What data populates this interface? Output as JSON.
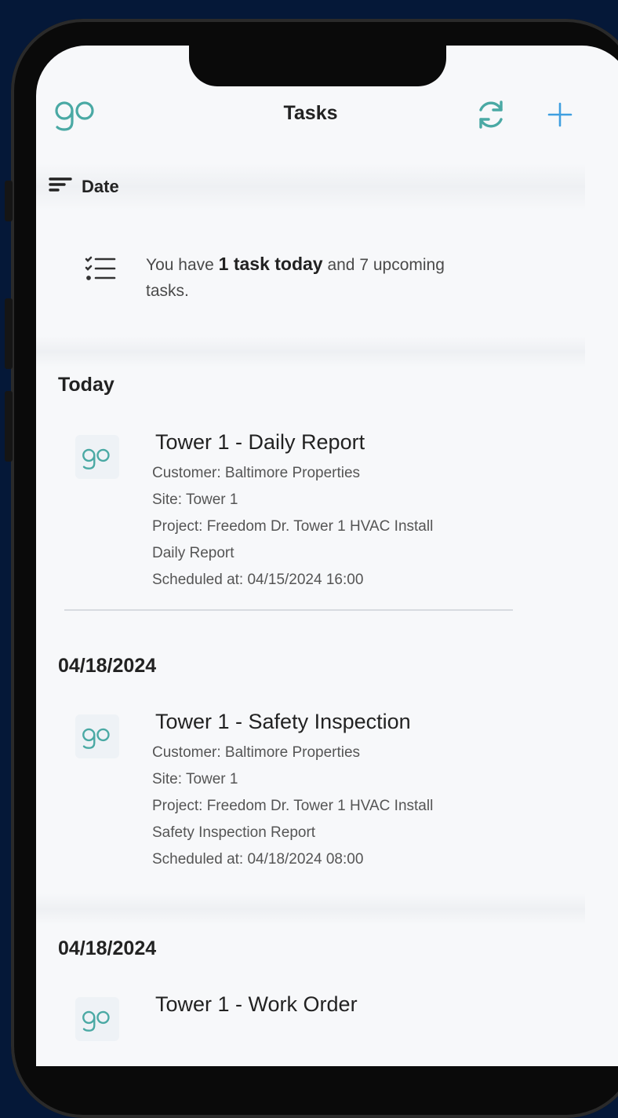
{
  "header": {
    "title": "Tasks"
  },
  "sort": {
    "label": "Date"
  },
  "summary": {
    "prefix": "You have ",
    "bold": "1 task today",
    "suffix": " and 7 upcoming tasks."
  },
  "sections": [
    {
      "header": "Today",
      "task": {
        "title": "Tower 1 - Daily Report",
        "customer": "Customer: Baltimore Properties",
        "site": "Site: Tower 1",
        "project": "Project: Freedom Dr. Tower 1 HVAC Install",
        "type": "Daily Report",
        "scheduled": "Scheduled at: 04/15/2024 16:00"
      }
    },
    {
      "header": "04/18/2024",
      "task": {
        "title": "Tower 1 - Safety Inspection",
        "customer": "Customer: Baltimore Properties",
        "site": "Site: Tower 1",
        "project": "Project: Freedom Dr. Tower 1 HVAC Install",
        "type": "Safety Inspection Report",
        "scheduled": "Scheduled at: 04/18/2024 08:00"
      }
    },
    {
      "header": "04/18/2024",
      "task": {
        "title": "Tower 1 - Work Order"
      }
    }
  ],
  "colors": {
    "brand": "#4aa9a4",
    "accent": "#3f9fe0",
    "background": "#051838"
  }
}
